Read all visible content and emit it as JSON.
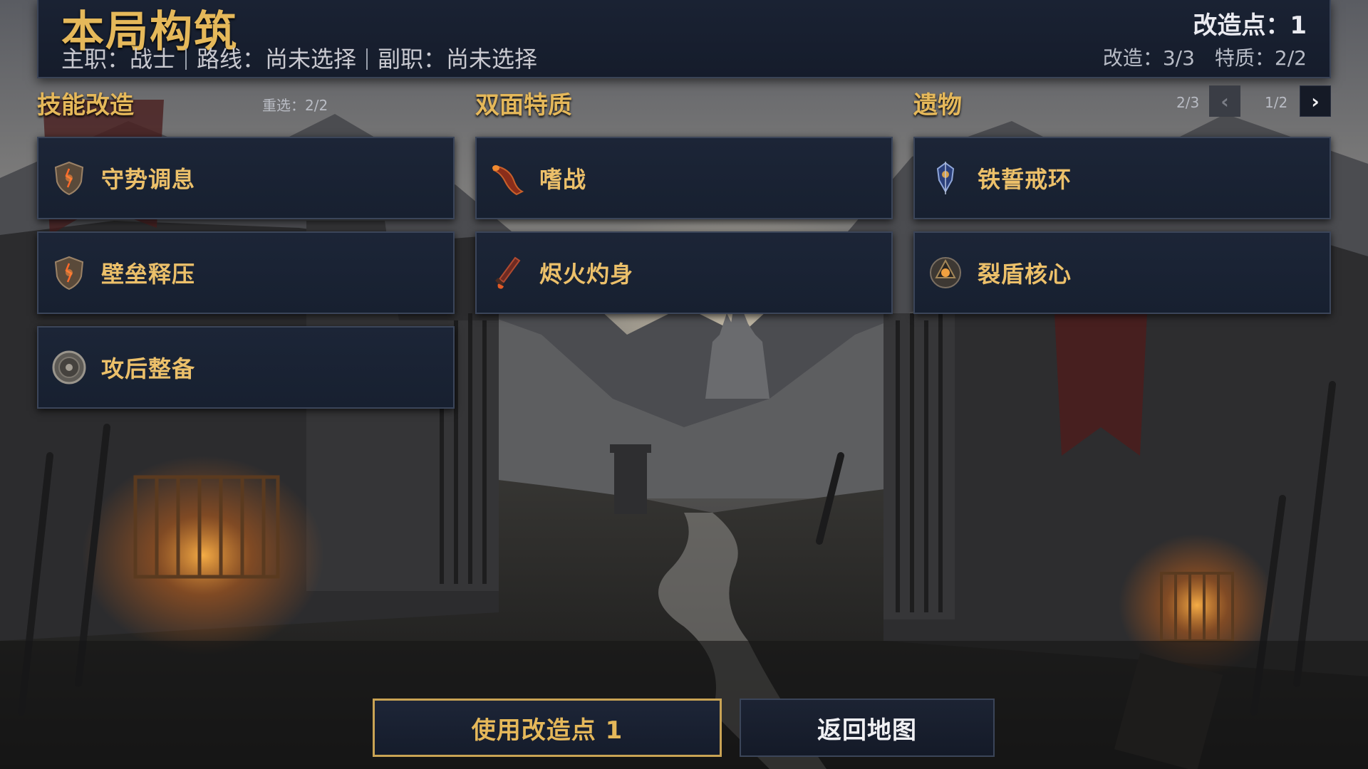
{
  "header": {
    "title": "本局构筑",
    "class_label": "主职：战士",
    "route_label": "路线：尚未选择",
    "sub_label": "副职：尚未选择",
    "points_label": "改造点：1",
    "mod_count": "改造：3/3",
    "trait_count": "特质：2/2"
  },
  "sections": {
    "skills": {
      "title": "技能改造",
      "reroll": "重选：2/2"
    },
    "traits": {
      "title": "双面特质"
    },
    "relics": {
      "title": "遗物",
      "left_page": "2/3",
      "right_page": "1/2",
      "prev_icon": "‹",
      "next_icon": "›"
    }
  },
  "skills": [
    {
      "label": "守势调息",
      "icon": "cracked-shield-icon"
    },
    {
      "label": "壁垒释压",
      "icon": "cracked-shield-icon"
    },
    {
      "label": "攻后整备",
      "icon": "round-shield-icon"
    }
  ],
  "traits": [
    {
      "label": "嗜战",
      "icon": "war-horn-icon"
    },
    {
      "label": "烬火灼身",
      "icon": "flaming-blade-icon"
    }
  ],
  "relics": [
    {
      "label": "铁誓戒环",
      "icon": "blue-crest-icon"
    },
    {
      "label": "裂盾核心",
      "icon": "orb-shield-icon"
    }
  ],
  "actions": {
    "use_label": "使用改造点 1",
    "back_label": "返回地图"
  },
  "colors": {
    "gold": "#e5b85a",
    "panel": "#1a2233",
    "border": "#3b4559"
  }
}
